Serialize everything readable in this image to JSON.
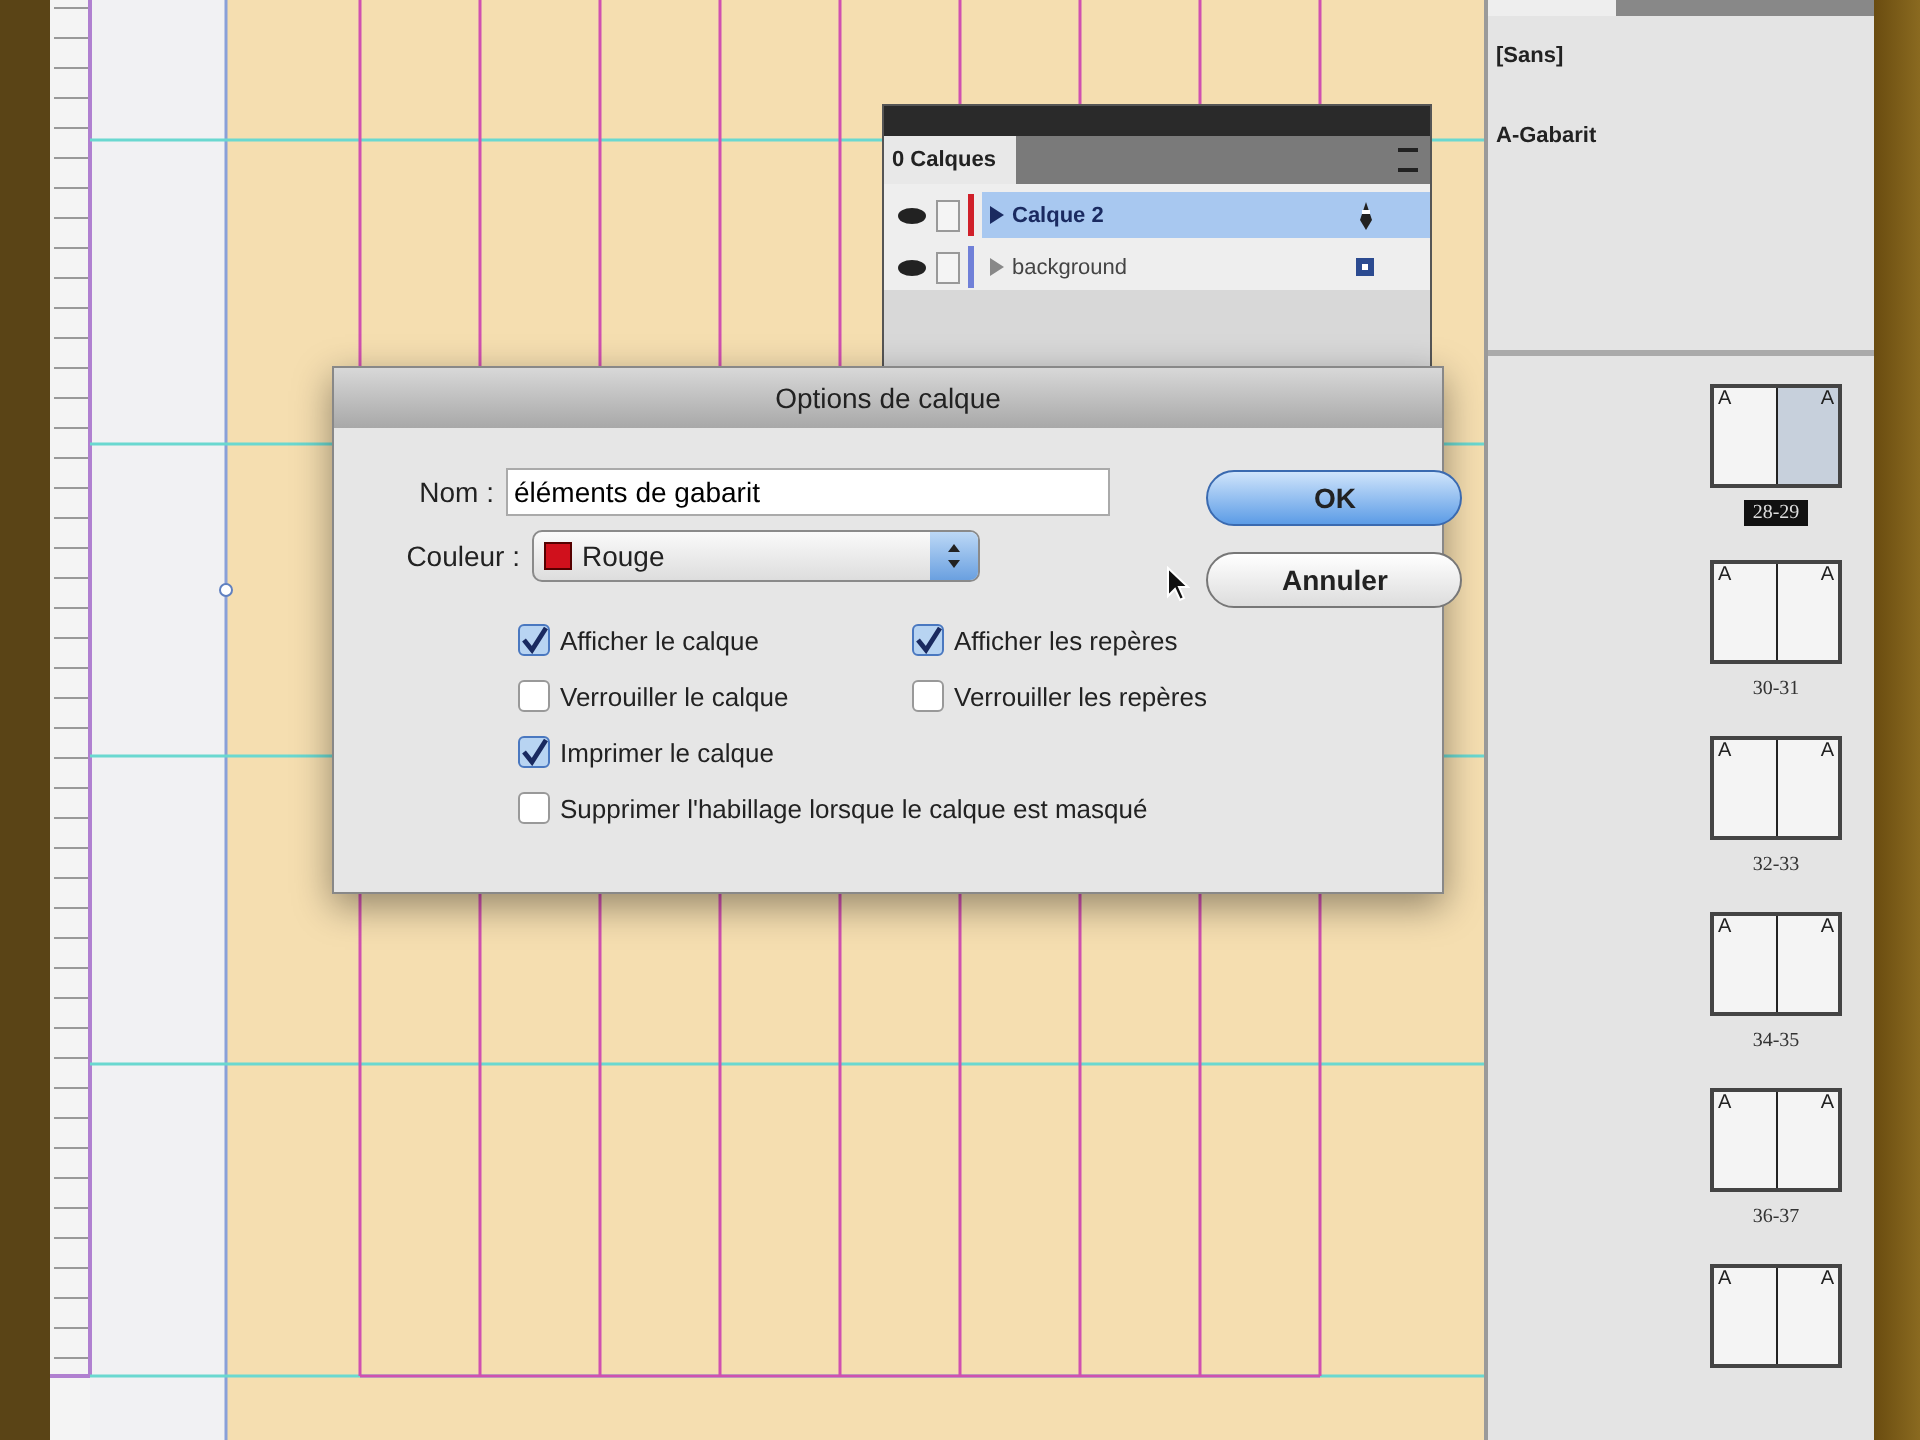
{
  "layers_panel": {
    "tab": "0 Calques",
    "layers": [
      {
        "name": "Calque 2",
        "selected": true,
        "color": "#d0202a"
      },
      {
        "name": "background",
        "selected": false,
        "color": "#7080d8"
      }
    ]
  },
  "dialog": {
    "title": "Options de calque",
    "name_label": "Nom :",
    "name_value": "éléments de gabarit",
    "color_label": "Couleur :",
    "color_value": "Rouge",
    "buttons": [
      {
        "label": "OK",
        "kind": "default"
      },
      {
        "label": "Annuler",
        "kind": "normal"
      }
    ],
    "options": [
      {
        "label": "Afficher le calque",
        "checked": true
      },
      {
        "label": "Afficher les repères",
        "checked": true
      },
      {
        "label": "Verrouiller le calque",
        "checked": false
      },
      {
        "label": "Verrouiller les repères",
        "checked": false
      },
      {
        "label": "Imprimer le calque",
        "checked": true
      },
      {
        "label": "Supprimer l'habillage lorsque le calque est masqué",
        "checked": false
      }
    ]
  },
  "pages_panel": {
    "masters": [
      "[Sans]",
      "A-Gabarit"
    ],
    "spreads": [
      {
        "label": "28-29",
        "selected": true,
        "pages": [
          "A",
          "A"
        ]
      },
      {
        "label": "30-31",
        "selected": false,
        "pages": [
          "A",
          "A"
        ]
      },
      {
        "label": "32-33",
        "selected": false,
        "pages": [
          "A",
          "A"
        ]
      },
      {
        "label": "34-35",
        "selected": false,
        "pages": [
          "A",
          "A"
        ]
      },
      {
        "label": "36-37",
        "selected": false,
        "pages": [
          "A",
          "A"
        ]
      },
      {
        "selected": false,
        "pages": [
          "A",
          "A"
        ]
      }
    ]
  }
}
